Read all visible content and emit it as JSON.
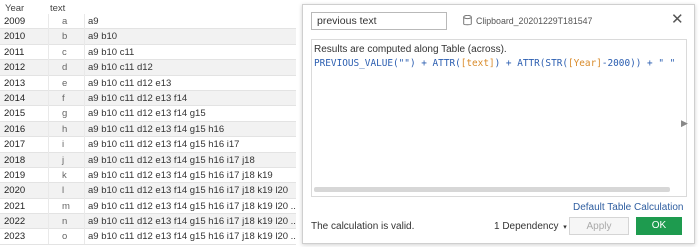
{
  "table": {
    "headers": {
      "year": "Year",
      "text": "text"
    },
    "rows": [
      {
        "year": "2009",
        "letter": "a",
        "text": "a9"
      },
      {
        "year": "2010",
        "letter": "b",
        "text": "a9 b10"
      },
      {
        "year": "2011",
        "letter": "c",
        "text": "a9 b10 c11"
      },
      {
        "year": "2012",
        "letter": "d",
        "text": "a9 b10 c11 d12"
      },
      {
        "year": "2013",
        "letter": "e",
        "text": "a9 b10 c11 d12 e13"
      },
      {
        "year": "2014",
        "letter": "f",
        "text": "a9 b10 c11 d12 e13 f14"
      },
      {
        "year": "2015",
        "letter": "g",
        "text": "a9 b10 c11 d12 e13 f14 g15"
      },
      {
        "year": "2016",
        "letter": "h",
        "text": "a9 b10 c11 d12 e13 f14 g15 h16"
      },
      {
        "year": "2017",
        "letter": "i",
        "text": "a9 b10 c11 d12 e13 f14 g15 h16 i17"
      },
      {
        "year": "2018",
        "letter": "j",
        "text": "a9 b10 c11 d12 e13 f14 g15 h16 i17 j18"
      },
      {
        "year": "2019",
        "letter": "k",
        "text": "a9 b10 c11 d12 e13 f14 g15 h16 i17 j18 k19"
      },
      {
        "year": "2020",
        "letter": "l",
        "text": "a9 b10 c11 d12 e13 f14 g15 h16 i17 j18 k19 l20"
      },
      {
        "year": "2021",
        "letter": "m",
        "text": "a9 b10 c11 d12 e13 f14 g15 h16 i17 j18 k19 l20 .."
      },
      {
        "year": "2022",
        "letter": "n",
        "text": "a9 b10 c11 d12 e13 f14 g15 h16 i17 j18 k19 l20 .."
      },
      {
        "year": "2023",
        "letter": "o",
        "text": "a9 b10 c11 d12 e13 f14 g15 h16 i17 j18 k19 l20 .."
      }
    ]
  },
  "dialog": {
    "calc_name": "previous text",
    "source_icon": "database-icon",
    "source_name": "Clipboard_20201229T181547",
    "close_glyph": "✕",
    "scope_note": "Results are computed along Table (across).",
    "formula": {
      "p1": "PREVIOUS_VALUE(\"\") + ATTR(",
      "field1": "[text]",
      "p2": ") + ATTR(STR(",
      "field2": "[Year]",
      "p3": "-2000)) + \" \""
    },
    "expand_glyph": "▶",
    "default_calc_link": "Default Table Calculation",
    "validity_message": "The calculation is valid.",
    "dependency_label": "1 Dependency",
    "dependency_caret": "▾",
    "apply_label": "Apply",
    "ok_label": "OK",
    "colors": {
      "ok_button": "#1e9b4f",
      "link": "#2f5ea0",
      "field": "#d98b2b",
      "formula": "#2a5db0"
    }
  }
}
